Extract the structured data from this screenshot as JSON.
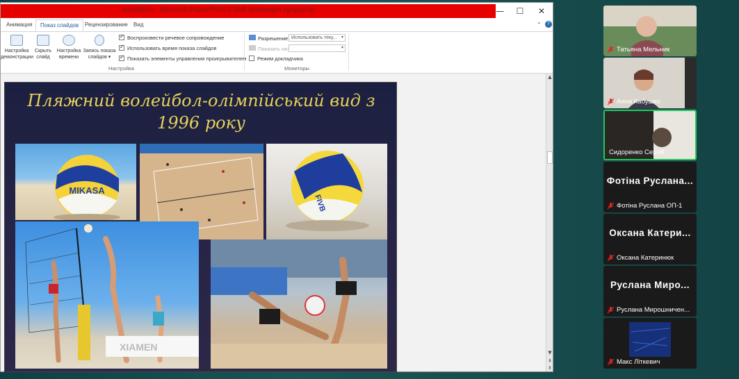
{
  "window": {
    "title": "волейбол  -  Microsoft PowerPoint (Сбой активации продукта)",
    "min": "—",
    "max": "☐",
    "close": "✕"
  },
  "tabs": [
    "Анимация",
    "Показ слайдов",
    "Рецензирование",
    "Вид"
  ],
  "active_tab": "Показ слайдов",
  "ribbon": {
    "buttons": [
      {
        "label1": "Настройка",
        "label2": "демонстрации"
      },
      {
        "label1": "Скрыть",
        "label2": "слайд"
      },
      {
        "label1": "Настройка",
        "label2": "времени"
      },
      {
        "label1": "Запись показа",
        "label2": "слайдов ▾"
      }
    ],
    "checkboxes": [
      {
        "label": "Воспроизвести речевое сопровождение",
        "checked": true
      },
      {
        "label": "Использовать время показа слайдов",
        "checked": true
      },
      {
        "label": "Показать элементы управления проигрывателем",
        "checked": true
      }
    ],
    "group_setup": "Настройка",
    "resolution_label": "Разрешение:",
    "resolution_value": "Использовать теку...",
    "show_on_label": "Показать на:",
    "show_on_value": "",
    "presenter_view": "Режим докладчика",
    "group_monitors": "Мониторы",
    "help": "?",
    "collapse": "⌃"
  },
  "slide": {
    "title_line1": "Пляжний волейбол-олімпійський вид з",
    "title_line2": "1996 року",
    "ball_brand": "MIKASA",
    "ball_label": "FIVB",
    "banner": "XIAMEN"
  },
  "participants": [
    {
      "name": "Татьяна Мельник",
      "muted": true,
      "video": true
    },
    {
      "name": "Анна Кабушко",
      "muted": true,
      "video": true
    },
    {
      "name": "Сидоренко Сергій",
      "muted": false,
      "video": true,
      "active": true
    },
    {
      "big": "Фотіна  Руслана...",
      "name": "Фотіна Руслана ОП-1",
      "muted": true
    },
    {
      "big": "Оксана  Катери...",
      "name": "Оксана Катеринюк",
      "muted": true
    },
    {
      "big": "Руслана  Миро...",
      "name": "Руслана Мирошничен...",
      "muted": true
    },
    {
      "name": "Макс Літкевич",
      "muted": true,
      "video": true
    }
  ],
  "colors": {
    "title_bar_red": "#e60000",
    "slide_title": "#e6d25a",
    "active_speaker": "#26c75a",
    "muted_mic": "#e0262a"
  }
}
